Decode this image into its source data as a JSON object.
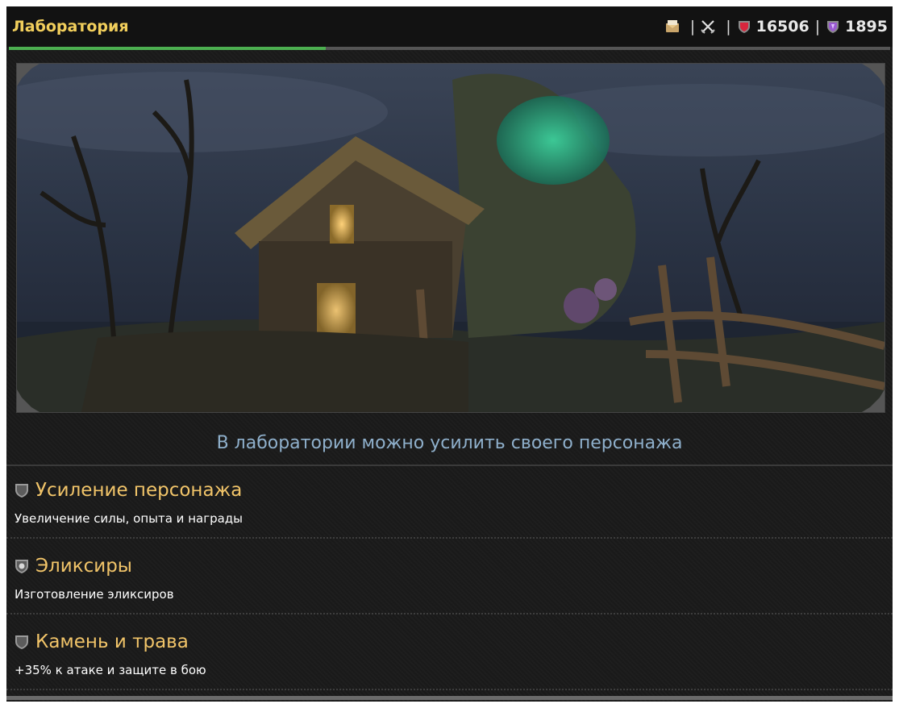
{
  "header": {
    "title": "Лаборатория",
    "separator": "|",
    "stats": [
      {
        "icon": "mail-icon"
      },
      {
        "icon": "crossed-swords-icon"
      },
      {
        "icon": "red-shield-icon",
        "value": "16506"
      },
      {
        "icon": "purple-gem-icon",
        "value": "1895"
      }
    ],
    "progress": 0.36
  },
  "banner": {
    "scene": "witch-hut-illustration"
  },
  "subtitle": "В лаборатории можно усилить своего персонажа",
  "menu": [
    {
      "title": "Усиление персонажа",
      "description": "Увеличение силы, опыта и награды",
      "icon": "shield-icon"
    },
    {
      "title": "Эликсиры",
      "description": "Изготовление эликсиров",
      "icon": "elixir-shield-icon"
    },
    {
      "title": "Камень и трава",
      "description": "+35% к атаке и защите в бою",
      "icon": "shield-icon"
    }
  ],
  "colors": {
    "title": "#f2cf5c",
    "link": "#f1c469",
    "subtitle": "#8fb0cc",
    "progress": "#4caf50",
    "background": "#1a1a1a"
  }
}
